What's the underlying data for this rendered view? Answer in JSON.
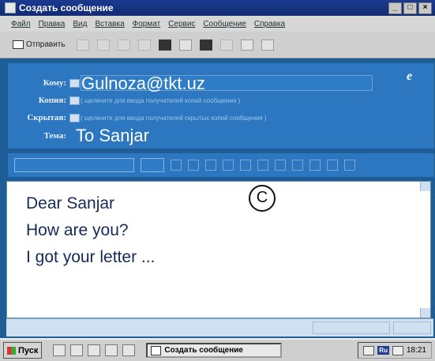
{
  "window": {
    "title": "Создать сообщение",
    "controls": [
      "_",
      "□",
      "×"
    ]
  },
  "menu": [
    "Файл",
    "Правка",
    "Вид",
    "Вставка",
    "Формат",
    "Сервис",
    "Сообщение",
    "Справка"
  ],
  "toolbar": {
    "send_label": "Отправить",
    "icons": [
      "cut-icon",
      "copy-icon",
      "paste-icon",
      "undo-icon",
      "check-names-icon",
      "spelling-icon",
      "attach-icon",
      "priority-icon",
      "sign-icon",
      "encrypt-icon"
    ]
  },
  "header": {
    "to_label": "Кому:",
    "to_value": "Gulnoza@tkt.uz",
    "cc_label": "Копия:",
    "cc_hint": "( щелкните для ввода получателей копий сообщения )",
    "bcc_label": "Скрытая:",
    "bcc_hint": "( щелкните для ввода получателей скрытых копий сообщения )",
    "subject_label": "Тема:",
    "subject_value": "To Sanjar"
  },
  "body": {
    "lines": [
      "Dear Sanjar",
      "How are you?",
      "I got your letter ..."
    ],
    "circle_label": "C"
  },
  "taskbar": {
    "start_label": "Пуск",
    "task_label": "Создать сообщение",
    "lang": "Ru",
    "clock": "18:21"
  }
}
